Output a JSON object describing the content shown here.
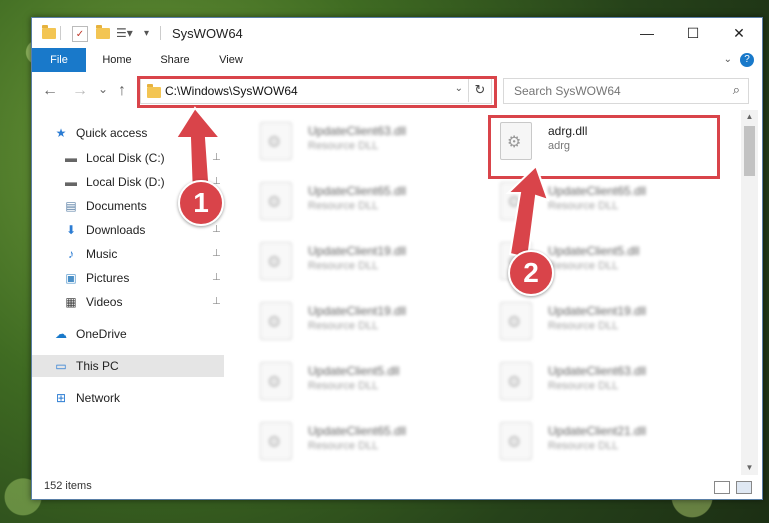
{
  "window": {
    "title": "SysWOW64",
    "controls": {
      "minimize": "—",
      "maximize": "☐",
      "close": "✕"
    }
  },
  "ribbon": {
    "tabs": [
      "File",
      "Home",
      "Share",
      "View"
    ],
    "expand_icon": "chevron-down-icon",
    "help_icon": "help-icon",
    "help_glyph": "?"
  },
  "navigation": {
    "back": "←",
    "forward": "→",
    "recent": "⌄",
    "up": "↑",
    "address": "C:\\Windows\\SysWOW64",
    "refresh": "↻",
    "search_placeholder": "Search SysWOW64"
  },
  "sidebar": {
    "items": [
      {
        "label": "Quick access",
        "icon": "star-icon",
        "glyph": "★",
        "color": "#2b7cd3",
        "pinned": false,
        "selected": false
      },
      {
        "label": "Local Disk (C:)",
        "icon": "drive-icon",
        "glyph": "▬",
        "color": "#666666",
        "pinned": true,
        "selected": false
      },
      {
        "label": "Local Disk (D:)",
        "icon": "drive-icon",
        "glyph": "▬",
        "color": "#666666",
        "pinned": true,
        "selected": false
      },
      {
        "label": "Documents",
        "icon": "documents-icon",
        "glyph": "▤",
        "color": "#5a7fa6",
        "pinned": true,
        "selected": false
      },
      {
        "label": "Downloads",
        "icon": "download-icon",
        "glyph": "⬇",
        "color": "#2b7cd3",
        "pinned": true,
        "selected": false
      },
      {
        "label": "Music",
        "icon": "music-icon",
        "glyph": "♪",
        "color": "#2b7cd3",
        "pinned": true,
        "selected": false
      },
      {
        "label": "Pictures",
        "icon": "pictures-icon",
        "glyph": "▣",
        "color": "#4a90c8",
        "pinned": true,
        "selected": false
      },
      {
        "label": "Videos",
        "icon": "videos-icon",
        "glyph": "▦",
        "color": "#444444",
        "pinned": true,
        "selected": false
      },
      {
        "label": "OneDrive",
        "icon": "cloud-icon",
        "glyph": "☁",
        "color": "#1979ca",
        "pinned": false,
        "selected": false
      },
      {
        "label": "This PC",
        "icon": "computer-icon",
        "glyph": "▭",
        "color": "#2b7cd3",
        "pinned": false,
        "selected": true
      },
      {
        "label": "Network",
        "icon": "network-icon",
        "glyph": "⊞",
        "color": "#2b7cd3",
        "pinned": false,
        "selected": false
      }
    ],
    "pin_glyph": "📌"
  },
  "files": {
    "left_column": [
      {
        "name": "UpdateClient63.dll",
        "desc": "Resource DLL"
      },
      {
        "name": "UpdateClient65.dll",
        "desc": "Resource DLL"
      },
      {
        "name": "UpdateClient19.dll",
        "desc": "Resource DLL"
      },
      {
        "name": "UpdateClient19.dll",
        "desc": "Resource DLL"
      },
      {
        "name": "UpdateClient5.dll",
        "desc": "Resource DLL"
      },
      {
        "name": "UpdateClient65.dll",
        "desc": "Resource DLL"
      }
    ],
    "right_column": [
      {
        "name": "adrg.dll",
        "desc": "adrg",
        "highlighted": true
      },
      {
        "name": "UpdateClient65.dll",
        "desc": "Resource DLL"
      },
      {
        "name": "UpdateClient5.dll",
        "desc": "Resource DLL"
      },
      {
        "name": "UpdateClient19.dll",
        "desc": "Resource DLL"
      },
      {
        "name": "UpdateClient63.dll",
        "desc": "Resource DLL"
      },
      {
        "name": "UpdateClient21.dll",
        "desc": "Resource DLL"
      }
    ]
  },
  "status": {
    "item_count": "152 items"
  },
  "annotations": {
    "step1": "1",
    "step2": "2",
    "color": "#d9444a"
  }
}
